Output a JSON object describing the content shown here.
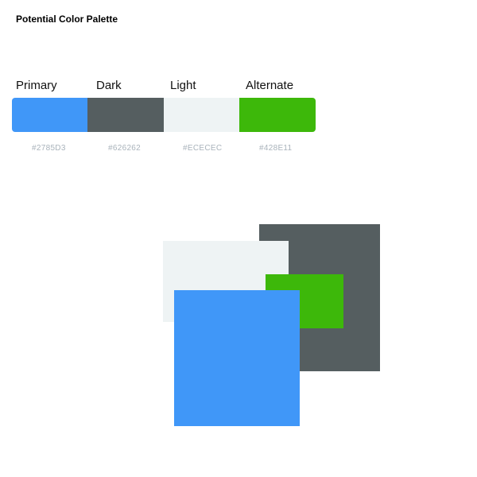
{
  "title": "Potential Color Palette",
  "palette": [
    {
      "name": "Primary",
      "hex_label": "#2785D3",
      "display_color": "#4097f8"
    },
    {
      "name": "Dark",
      "hex_label": "#626262",
      "display_color": "#555e60"
    },
    {
      "name": "Light",
      "hex_label": "#ECECEC",
      "display_color": "#eef3f4"
    },
    {
      "name": "Alternate",
      "hex_label": "#428E11",
      "display_color": "#3db80a"
    }
  ]
}
